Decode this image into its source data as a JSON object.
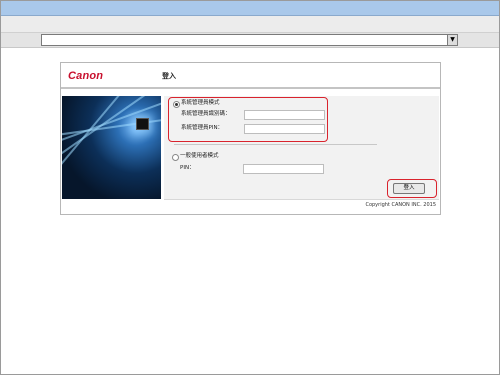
{
  "login": {
    "brand": "Canon",
    "heading": "登入",
    "sysadmin_mode": "系統管理員模式",
    "sysadmin_id_label": "系統管理員識別碼：",
    "sysadmin_pin_label": "系統管理員PIN：",
    "general_mode": "一般使用者模式",
    "pin_label": "PIN：",
    "login_button": "登入",
    "copyright": "Copyright CANON INC. 2015"
  },
  "colors": {
    "brand": "#c8102e",
    "highlight": "#d9232d"
  }
}
